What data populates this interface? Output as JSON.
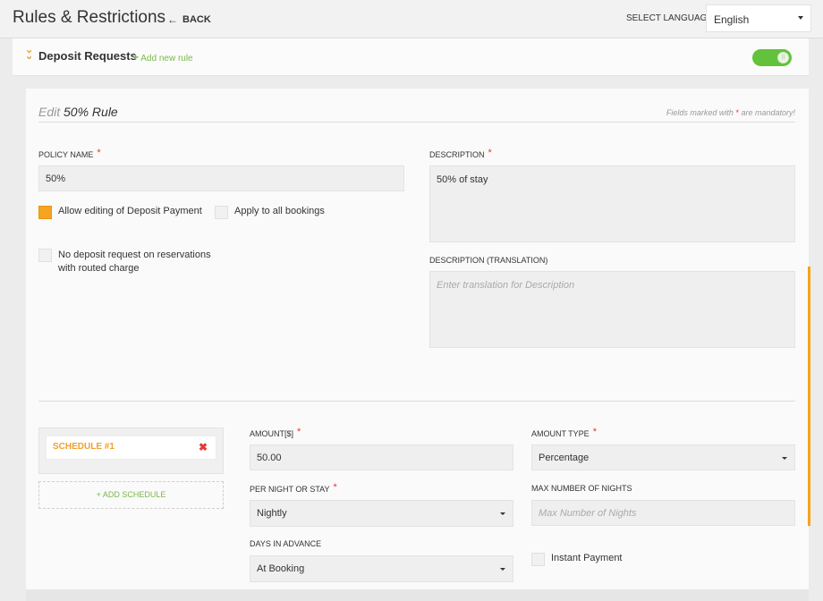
{
  "header": {
    "title": "Rules & Restrictions",
    "back_label": "BACK",
    "language_label": "SELECT LANGUAGE",
    "language_value": "English"
  },
  "section": {
    "title": "Deposit Requests",
    "add_rule_label": "Add new rule",
    "toggle_on": true
  },
  "form": {
    "edit_prefix": "Edit",
    "rule_name": "50% Rule",
    "mandatory_note_pre": "Fields marked with",
    "mandatory_note_post": "are mandatory!",
    "policy_name_label": "POLICY NAME",
    "policy_name_value": "50%",
    "allow_editing_label": "Allow editing of Deposit Payment",
    "allow_editing_checked": true,
    "apply_all_label": "Apply to all bookings",
    "apply_all_checked": false,
    "no_deposit_label_line1": "No deposit request on reservations",
    "no_deposit_label_line2": "with routed charge",
    "no_deposit_checked": false,
    "description_label": "DESCRIPTION",
    "description_value": "50% of stay",
    "description_translation_label": "DESCRIPTION (TRANSLATION)",
    "description_translation_placeholder": "Enter translation for Description"
  },
  "schedule": {
    "item_label": "SCHEDULE #1",
    "add_label": "+ ADD SCHEDULE",
    "amount_label": "AMOUNT[$]",
    "amount_value": "50.00",
    "amount_type_label": "AMOUNT TYPE",
    "amount_type_value": "Percentage",
    "per_night_label": "PER NIGHT OR STAY",
    "per_night_value": "Nightly",
    "max_nights_label": "MAX NUMBER OF NIGHTS",
    "max_nights_placeholder": "Max Number of Nights",
    "days_advance_label": "DAYS IN ADVANCE",
    "days_advance_value": "At Booking",
    "instant_payment_label": "Instant Payment",
    "instant_payment_checked": false
  },
  "colors": {
    "accent_orange": "#f5a41e",
    "accent_green": "#62c23b",
    "required_red": "#e53935"
  }
}
